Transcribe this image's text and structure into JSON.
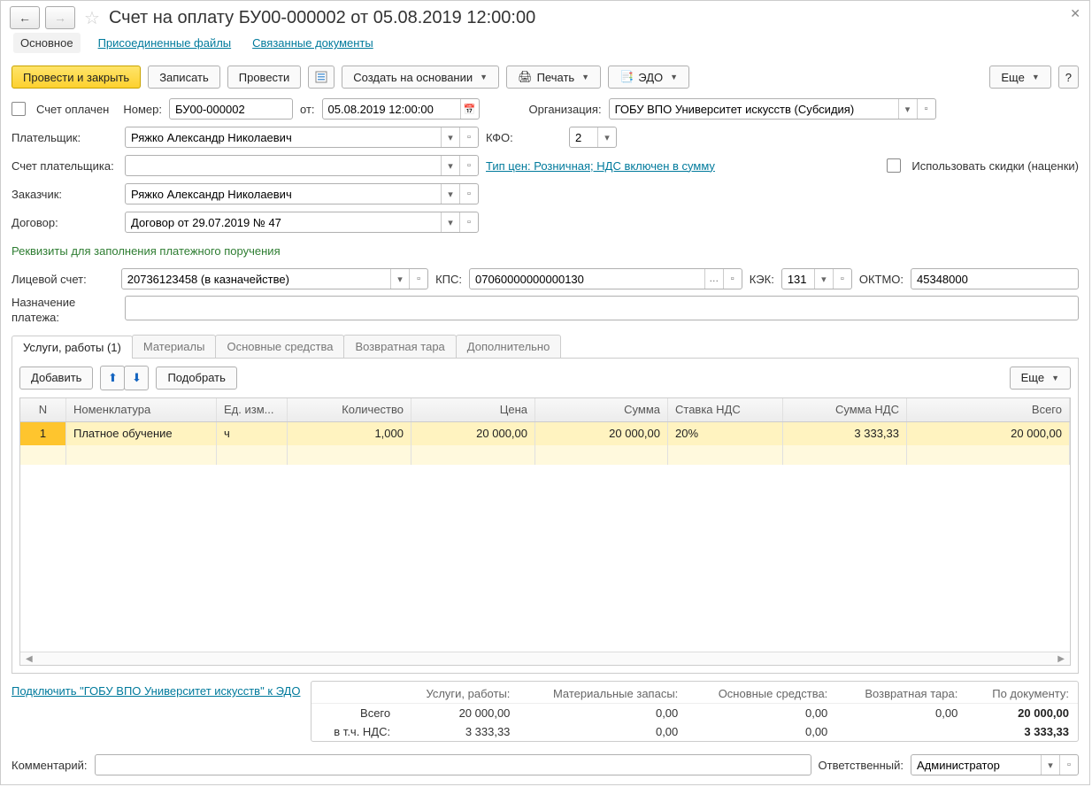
{
  "title": "Счет на оплату БУ00-000002 от 05.08.2019 12:00:00",
  "subnav": {
    "main": "Основное",
    "files": "Присоединенные файлы",
    "linked": "Связанные документы"
  },
  "toolbar": {
    "post_close": "Провести и закрыть",
    "save": "Записать",
    "post": "Провести",
    "create_based": "Создать на основании",
    "print": "Печать",
    "edo": "ЭДО",
    "more": "Еще",
    "help": "?"
  },
  "header": {
    "paid_label": "Счет оплачен",
    "number_label": "Номер:",
    "number": "БУ00-000002",
    "from_label": "от:",
    "date": "05.08.2019 12:00:00",
    "org_label": "Организация:",
    "org": "ГОБУ ВПО Университет искусств (Субсидия)",
    "payer_label": "Плательщик:",
    "payer": "Ряжко Александр Николаевич",
    "kfo_label": "КФО:",
    "kfo": "2",
    "payer_acc_label": "Счет плательщика:",
    "price_type": "Тип цен: Розничная; НДС включен в сумму",
    "discount_label": "Использовать скидки (наценки)",
    "customer_label": "Заказчик:",
    "customer": "Ряжко Александр Николаевич",
    "contract_label": "Договор:",
    "contract": "Договор от 29.07.2019 № 47",
    "req_caption": "Реквизиты для заполнения платежного поручения",
    "pers_acc_label": "Лицевой счет:",
    "pers_acc": "20736123458 (в казначействе)",
    "kps_label": "КПС:",
    "kps": "07060000000000130",
    "kek_label": "КЭК:",
    "kek": "131",
    "oktmo_label": "ОКТМО:",
    "oktmo": "45348000",
    "purpose_label": "Назначение платежа:"
  },
  "tabs": {
    "services": "Услуги, работы (1)",
    "materials": "Материалы",
    "assets": "Основные средства",
    "tare": "Возвратная тара",
    "extra": "Дополнительно"
  },
  "tab_toolbar": {
    "add": "Добавить",
    "select": "Подобрать",
    "more": "Еще"
  },
  "grid": {
    "cols": {
      "n": "N",
      "nom": "Номенклатура",
      "ed": "Ед. изм...",
      "kol": "Количество",
      "cen": "Цена",
      "sum": "Сумма",
      "vat": "Ставка НДС",
      "nds": "Сумма НДС",
      "tot": "Всего"
    },
    "rows": [
      {
        "n": "1",
        "nom": "Платное обучение",
        "ed": "ч",
        "kol": "1,000",
        "cen": "20 000,00",
        "sum": "20 000,00",
        "vat": "20%",
        "nds": "3 333,33",
        "tot": "20 000,00"
      }
    ]
  },
  "edo_link": "Подключить \"ГОБУ ВПО Университет искусств\" к ЭДО",
  "totals": {
    "head": {
      "sv": "Услуги, работы:",
      "mz": "Материальные запасы:",
      "os": "Основные средства:",
      "vt": "Возвратная тара:",
      "doc": "По документу:"
    },
    "labels": {
      "total": "Всего",
      "vat": "в т.ч. НДС:"
    },
    "vals": {
      "sv_total": "20 000,00",
      "mz_total": "0,00",
      "os_total": "0,00",
      "vt_total": "0,00",
      "doc_total": "20 000,00",
      "sv_vat": "3 333,33",
      "mz_vat": "0,00",
      "os_vat": "0,00",
      "vt_vat": "",
      "doc_vat": "3 333,33"
    }
  },
  "footer": {
    "comment_label": "Комментарий:",
    "comment": "",
    "resp_label": "Ответственный:",
    "resp": "Администратор"
  }
}
